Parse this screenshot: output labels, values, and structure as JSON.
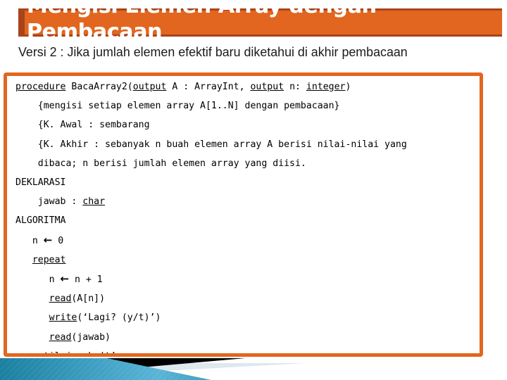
{
  "slide": {
    "title": "Mengisi Elemen Array dengan Pembacaan",
    "subtitle": "Versi 2 : Jika jumlah elemen efektif baru diketahui di akhir pembacaan"
  },
  "theme": {
    "accent_orange": "#e2661f",
    "accent_dark_orange": "#a8431a",
    "title_text": "#ffffff",
    "body_text": "#000000",
    "deco_blue_dark": "#1a7fa0",
    "deco_blue_light": "#4ba8cc",
    "deco_black": "#000000",
    "deco_pale": "#dde8ef"
  },
  "code": {
    "lines": [
      {
        "id": "line-signature",
        "indent": 0,
        "segments": [
          {
            "text": "procedure",
            "underline": true
          },
          {
            "text": " BacaArray2(",
            "underline": false
          },
          {
            "text": "output",
            "underline": true
          },
          {
            "text": " A : ArrayInt, ",
            "underline": false
          },
          {
            "text": "output",
            "underline": true
          },
          {
            "text": " n: ",
            "underline": false
          },
          {
            "text": "integer",
            "underline": true
          },
          {
            "text": ")",
            "underline": false
          }
        ]
      },
      {
        "id": "line-spec-desc",
        "indent": 4,
        "segments": [
          {
            "text": "{mengisi setiap elemen array A[1..N] dengan pembacaan}",
            "underline": false
          }
        ]
      },
      {
        "id": "line-kawal",
        "indent": 4,
        "segments": [
          {
            "text": "{K. Awal : sembarang",
            "underline": false
          }
        ]
      },
      {
        "id": "line-kakhir-1",
        "indent": 4,
        "segments": [
          {
            "text": "{K. Akhir : sebanyak n buah elemen array A berisi nilai-nilai yang",
            "underline": false
          }
        ]
      },
      {
        "id": "line-kakhir-2",
        "indent": 4,
        "segments": [
          {
            "text": "dibaca; n berisi jumlah elemen array yang diisi.",
            "underline": false
          }
        ]
      },
      {
        "id": "line-deklarasi",
        "indent": 0,
        "segments": [
          {
            "text": "DEKLARASI",
            "underline": false
          }
        ]
      },
      {
        "id": "line-jawab",
        "indent": 4,
        "segments": [
          {
            "text": "jawab : ",
            "underline": false
          },
          {
            "text": "char",
            "underline": true
          }
        ]
      },
      {
        "id": "line-algoritma",
        "indent": 0,
        "segments": [
          {
            "text": "ALGORITMA",
            "underline": false
          }
        ]
      },
      {
        "id": "line-n-init",
        "indent": 3,
        "segments": [
          {
            "text": "n ",
            "underline": false
          },
          {
            "text": "←",
            "underline": false,
            "arrow": true
          },
          {
            "text": " 0",
            "underline": false
          }
        ]
      },
      {
        "id": "line-repeat",
        "indent": 3,
        "segments": [
          {
            "text": "repeat",
            "underline": true
          }
        ]
      },
      {
        "id": "line-n-incr",
        "indent": 6,
        "segments": [
          {
            "text": "n ",
            "underline": false
          },
          {
            "text": "←",
            "underline": false,
            "arrow": true
          },
          {
            "text": " n + 1",
            "underline": false
          }
        ]
      },
      {
        "id": "line-read-a",
        "indent": 6,
        "segments": [
          {
            "text": "read",
            "underline": true
          },
          {
            "text": "(A[n])",
            "underline": false
          }
        ]
      },
      {
        "id": "line-write-lagi",
        "indent": 6,
        "segments": [
          {
            "text": "write",
            "underline": true
          },
          {
            "text": "(‘Lagi? (y/t)’)",
            "underline": false
          }
        ]
      },
      {
        "id": "line-read-jawab",
        "indent": 6,
        "segments": [
          {
            "text": "read",
            "underline": true
          },
          {
            "text": "(jawab)",
            "underline": false
          }
        ]
      },
      {
        "id": "line-until",
        "indent": 3,
        "segments": [
          {
            "text": "until",
            "underline": true
          },
          {
            "text": " jawab=‘t’",
            "underline": false
          }
        ]
      }
    ]
  }
}
